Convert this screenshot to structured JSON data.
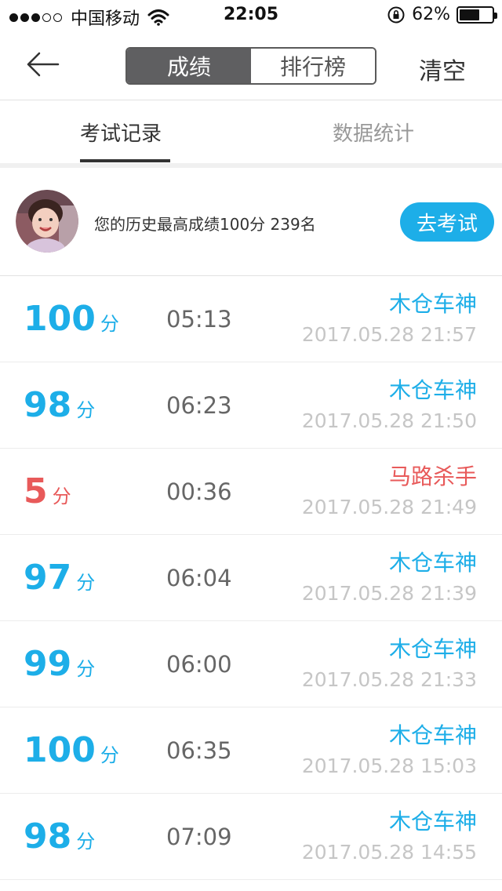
{
  "status_bar": {
    "carrier": "中国移动",
    "time": "22:05",
    "battery": "62%",
    "battery_level": 0.62,
    "signal_bars_filled": 3,
    "signal_bars_total": 5
  },
  "nav": {
    "back_icon": "arrow-left-icon",
    "segments": [
      "成绩",
      "排行榜"
    ],
    "active_segment": 0,
    "clear_label": "清空"
  },
  "tabs": {
    "records": "考试记录",
    "stats": "数据统计"
  },
  "profile": {
    "best_text": "您的历史最高成绩100分  239名",
    "go_exam_label": "去考试"
  },
  "colors": {
    "accent": "#1daee8",
    "fail": "#e85a5a",
    "segment_active": "#5f5f61"
  },
  "records": [
    {
      "score": "100",
      "unit": "分",
      "duration": "05:13",
      "title": "木仓车神",
      "datetime": "2017.05.28 21:57",
      "status": "pass"
    },
    {
      "score": "98",
      "unit": "分",
      "duration": "06:23",
      "title": "木仓车神",
      "datetime": "2017.05.28 21:50",
      "status": "pass"
    },
    {
      "score": "5",
      "unit": "分",
      "duration": "00:36",
      "title": "马路杀手",
      "datetime": "2017.05.28 21:49",
      "status": "fail"
    },
    {
      "score": "97",
      "unit": "分",
      "duration": "06:04",
      "title": "木仓车神",
      "datetime": "2017.05.28 21:39",
      "status": "pass"
    },
    {
      "score": "99",
      "unit": "分",
      "duration": "06:00",
      "title": "木仓车神",
      "datetime": "2017.05.28 21:33",
      "status": "pass"
    },
    {
      "score": "100",
      "unit": "分",
      "duration": "06:35",
      "title": "木仓车神",
      "datetime": "2017.05.28 15:03",
      "status": "pass"
    },
    {
      "score": "98",
      "unit": "分",
      "duration": "07:09",
      "title": "木仓车神",
      "datetime": "2017.05.28 14:55",
      "status": "pass"
    }
  ]
}
